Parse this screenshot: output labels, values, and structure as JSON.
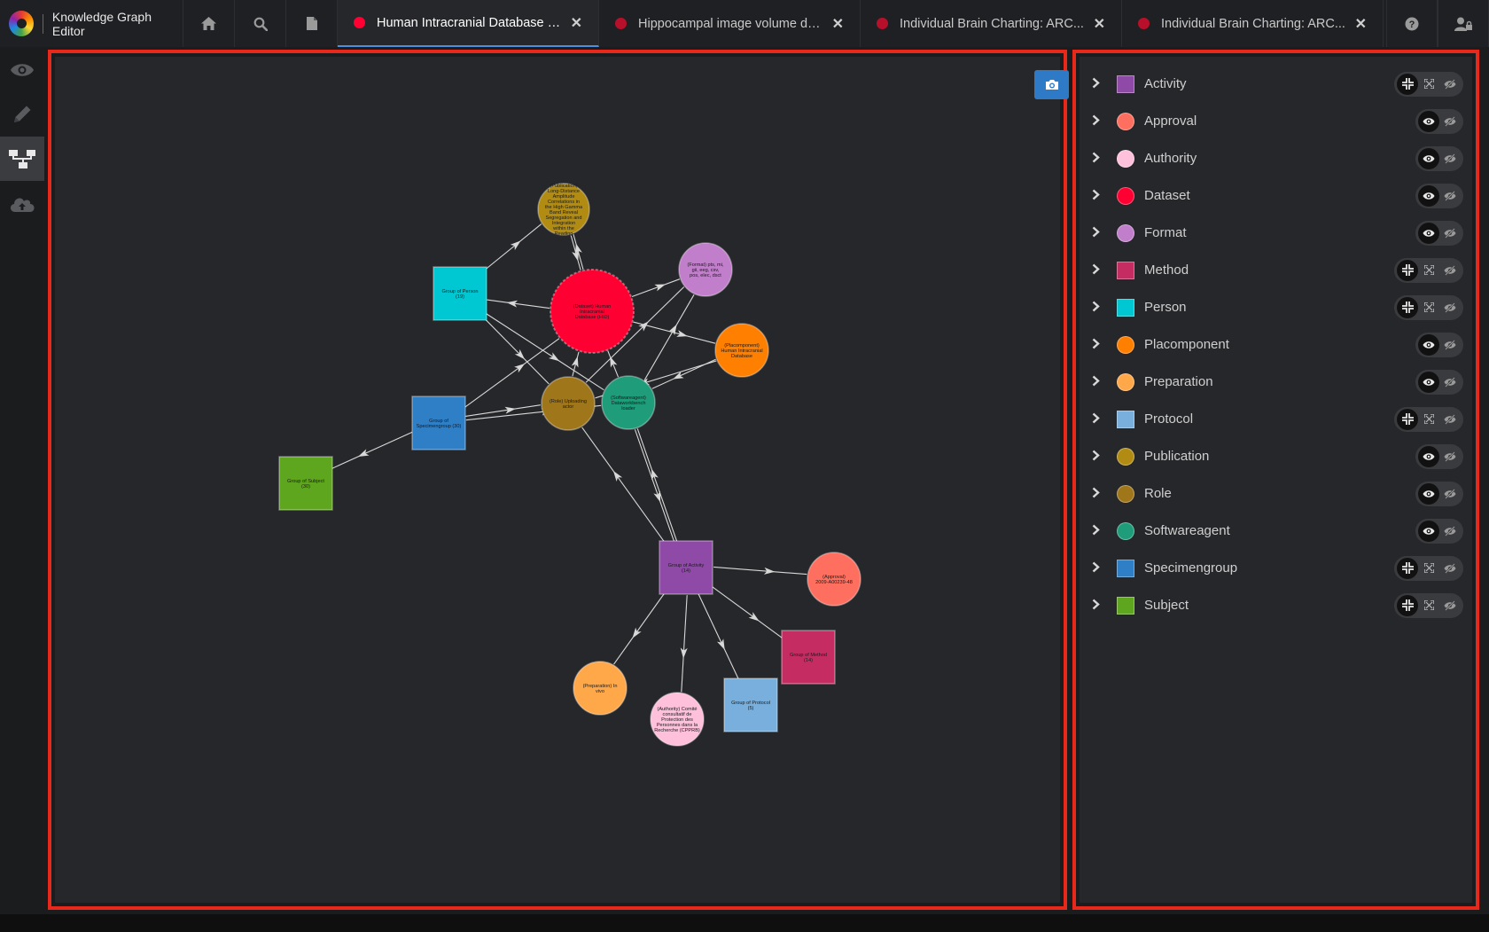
{
  "app": {
    "title": "Knowledge Graph Editor"
  },
  "tabs": [
    {
      "label": "Human Intracranial Database (...",
      "color": "#ff0033",
      "active": true
    },
    {
      "label": "Hippocampal image volume de...",
      "color": "#b8102a",
      "active": false
    },
    {
      "label": "Individual Brain Charting: ARC...",
      "color": "#b8102a",
      "active": false
    },
    {
      "label": "Individual Brain Charting: ARC...",
      "color": "#b8102a",
      "active": false
    }
  ],
  "graph": {
    "nodes": [
      {
        "id": "publication",
        "label": "(Publication) Long-Distance Amplitude Correlations in the High Gamma Band Reveal Segregation and Integration within the Reading",
        "shape": "circle",
        "color": "#b28c12"
      },
      {
        "id": "person",
        "label": "Group of Person (19)",
        "shape": "square",
        "color": "#00c8d2"
      },
      {
        "id": "dataset",
        "label": "(Dataset) Human Intracranial Database (HID)",
        "shape": "circle",
        "color": "#ff0033"
      },
      {
        "id": "format",
        "label": "(Format) pts, mi, gii, eeg, csv, pos, elec, dsct",
        "shape": "circle",
        "color": "#c17ecb"
      },
      {
        "id": "placomponent",
        "label": "(Placomponent) Human Intracranial Database",
        "shape": "circle",
        "color": "#ff7f00"
      },
      {
        "id": "role",
        "label": "(Role) Uploading actor",
        "shape": "circle",
        "color": "#a0761a"
      },
      {
        "id": "softwareagent",
        "label": "(Softwareagent) Dataworkbench loader",
        "shape": "circle",
        "color": "#1f9c7a"
      },
      {
        "id": "specimengroup",
        "label": "Group of Specimengroup (30)",
        "shape": "square",
        "color": "#2f7fc7"
      },
      {
        "id": "subject",
        "label": "Group of Subject (30)",
        "shape": "square",
        "color": "#5ea61d"
      },
      {
        "id": "activity",
        "label": "Group of Activity (14)",
        "shape": "square",
        "color": "#8f4aa8"
      },
      {
        "id": "approval",
        "label": "(Approval) 2009-A00239-48",
        "shape": "circle",
        "color": "#ff6f5f"
      },
      {
        "id": "method",
        "label": "Group of Method (14)",
        "shape": "square",
        "color": "#c52d62"
      },
      {
        "id": "preparation",
        "label": "(Preparation) In vivo",
        "shape": "circle",
        "color": "#ffa84a"
      },
      {
        "id": "authority",
        "label": "(Authority) Comité consultatif de Protection des Personnes dans la Recherche (CPPRB)",
        "shape": "circle",
        "color": "#ffc0dc"
      },
      {
        "id": "protocol",
        "label": "Group of Protocol (5)",
        "shape": "square",
        "color": "#79afdc"
      }
    ]
  },
  "types": [
    {
      "label": "Activity",
      "color": "#8f4aa8",
      "shape": "square",
      "controls": "group"
    },
    {
      "label": "Approval",
      "color": "#ff6f5f",
      "shape": "circle",
      "controls": "visibility"
    },
    {
      "label": "Authority",
      "color": "#ffc0dc",
      "shape": "circle",
      "controls": "visibility"
    },
    {
      "label": "Dataset",
      "color": "#ff0033",
      "shape": "circle",
      "controls": "visibility"
    },
    {
      "label": "Format",
      "color": "#c17ecb",
      "shape": "circle",
      "controls": "visibility"
    },
    {
      "label": "Method",
      "color": "#c52d62",
      "shape": "square",
      "controls": "group"
    },
    {
      "label": "Person",
      "color": "#00c8d2",
      "shape": "square",
      "controls": "group"
    },
    {
      "label": "Placomponent",
      "color": "#ff7f00",
      "shape": "circle",
      "controls": "visibility"
    },
    {
      "label": "Preparation",
      "color": "#ffa84a",
      "shape": "circle",
      "controls": "visibility"
    },
    {
      "label": "Protocol",
      "color": "#79afdc",
      "shape": "square",
      "controls": "group"
    },
    {
      "label": "Publication",
      "color": "#b28c12",
      "shape": "circle",
      "controls": "visibility"
    },
    {
      "label": "Role",
      "color": "#a0761a",
      "shape": "circle",
      "controls": "visibility"
    },
    {
      "label": "Softwareagent",
      "color": "#1f9c7a",
      "shape": "circle",
      "controls": "visibility"
    },
    {
      "label": "Specimengroup",
      "color": "#2f7fc7",
      "shape": "square",
      "controls": "group"
    },
    {
      "label": "Subject",
      "color": "#5ea61d",
      "shape": "square",
      "controls": "group"
    }
  ]
}
